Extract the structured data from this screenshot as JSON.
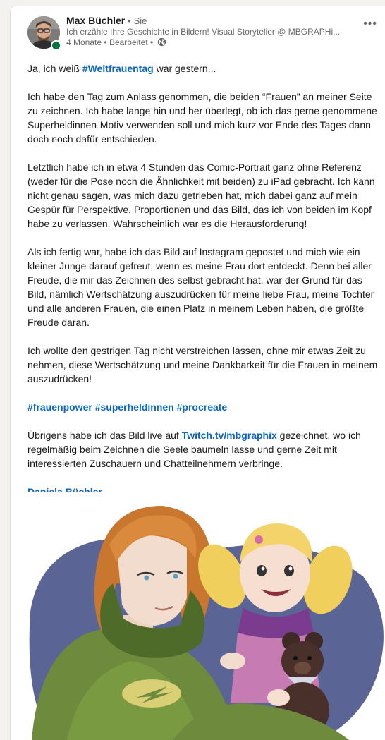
{
  "post": {
    "author": {
      "name": "Max Büchler",
      "separator": "•",
      "degree": "Sie",
      "headline": "Ich erzähle Ihre Geschichte in Bildern! Visual Storyteller @ MBGRAPHi...",
      "time": "4 Monate",
      "edited": "Bearbeitet",
      "visibility_icon": "globe-icon"
    },
    "more_label": "•••",
    "paragraphs": {
      "p1_pre": "Ja, ich weiß ",
      "p1_tag": "#Weltfrauentag",
      "p1_post": " war gestern...",
      "p2": "Ich habe den Tag zum Anlass genommen, die beiden “Frauen” an meiner Seite zu zeichnen. Ich habe lange hin und her überlegt, ob ich das gerne genommene Superheldinnen-Motiv verwenden soll und mich kurz vor Ende des Tages dann doch noch dafür entschieden.",
      "p3": "Letztlich habe ich in etwa 4 Stunden das Comic-Portrait ganz ohne Referenz (weder für die Pose noch die Ähnlichkeit mit beiden) zu iPad gebracht. Ich kann nicht genau sagen, was mich dazu getrieben hat, mich dabei ganz auf mein Gespür für Perspektive, Proportionen und das Bild, das ich von beiden im Kopf habe zu verlassen. Wahrscheinlich war es die Herausforderung!",
      "p4": "Als ich fertig war, habe ich das Bild auf Instagram gepostet und mich wie ein kleiner Junge darauf gefreut, wenn es meine Frau dort entdeckt. Denn bei aller Freude, die mir das Zeichnen des selbst gebracht hat, war der Grund für das Bild, nämlich Wertschätzung auszudrücken für meine liebe Frau, meine Tochter und alle anderen Frauen, die einen Platz in meinem Leben haben, die größte Freude daran.",
      "p5": "Ich wollte den gestrigen Tag nicht verstreichen lassen, ohne mir etwas Zeit zu nehmen, diese Wertschätzung und meine Dankbarkeit für die Frauen in meinem auszudrücken!",
      "hashtags": [
        "#frauenpower",
        "#superheldinnen",
        "#procreate"
      ],
      "p7_pre": "Übrigens habe ich das Bild live auf ",
      "p7_link": "Twitch.tv/mbgraphix",
      "p7_post": " gezeichnet, wo ich regelmäßig beim Zeichnen die Seele baumeln lasse und gerne Zeit mit interessierten Zuschauern und Chatteilnehmern verbringe.",
      "mention": "Daniela Büchler"
    },
    "image": {
      "subject": "comic-illustration-superheroine-mother-and-daughter"
    },
    "colors": {
      "link": "#0a66c2",
      "online": "#057642",
      "muted": "#666666"
    }
  }
}
